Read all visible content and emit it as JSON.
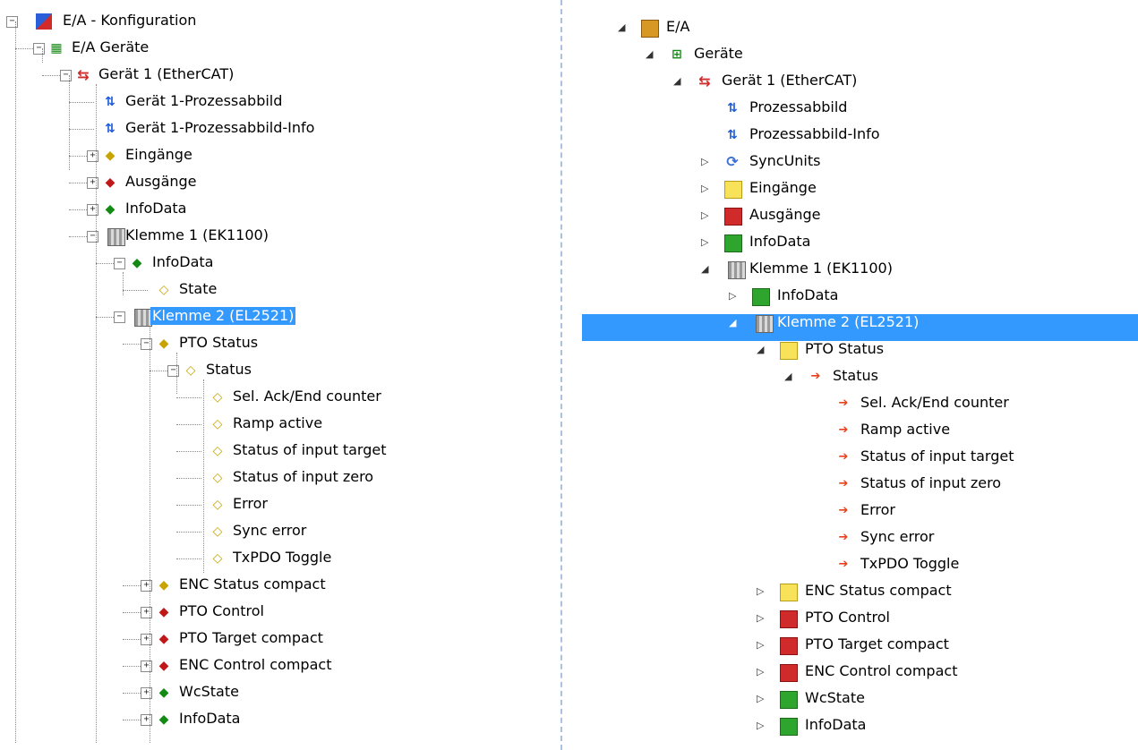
{
  "left_tree": {
    "root": "E/A - Konfiguration",
    "items": [
      {
        "label": "E/A Geräte",
        "level": 1,
        "icon": "device-group-icon",
        "expander": "minus"
      },
      {
        "label": "Gerät 1 (EtherCAT)",
        "level": 2,
        "icon": "ethercat-device-icon",
        "expander": "minus"
      },
      {
        "label": "Gerät 1-Prozessabbild",
        "level": 3,
        "icon": "process-image-icon",
        "expander": "none"
      },
      {
        "label": "Gerät 1-Prozessabbild-Info",
        "level": 3,
        "icon": "process-image-icon",
        "expander": "none"
      },
      {
        "label": "Eingänge",
        "level": 3,
        "icon": "input-icon",
        "expander": "plus"
      },
      {
        "label": "Ausgänge",
        "level": 3,
        "icon": "output-icon",
        "expander": "plus"
      },
      {
        "label": "InfoData",
        "level": 3,
        "icon": "infodata-icon",
        "expander": "plus"
      },
      {
        "label": "Klemme 1 (EK1100)",
        "level": 3,
        "icon": "terminal-icon",
        "expander": "minus"
      },
      {
        "label": "InfoData",
        "level": 4,
        "icon": "infodata-icon",
        "expander": "minus"
      },
      {
        "label": "State",
        "level": 5,
        "icon": "input-variable-icon",
        "expander": "none"
      },
      {
        "label": "Klemme 2 (EL2521)",
        "level": 4,
        "icon": "terminal-icon",
        "expander": "minus",
        "selected": true
      },
      {
        "label": "PTO Status",
        "level": 5,
        "icon": "input-icon",
        "expander": "minus"
      },
      {
        "label": "Status",
        "level": 6,
        "icon": "input-variable-icon",
        "expander": "minus"
      },
      {
        "label": "Sel. Ack/End counter",
        "level": 7,
        "icon": "input-variable-icon",
        "expander": "none"
      },
      {
        "label": "Ramp active",
        "level": 7,
        "icon": "input-variable-icon",
        "expander": "none"
      },
      {
        "label": "Status of input target",
        "level": 7,
        "icon": "input-variable-icon",
        "expander": "none"
      },
      {
        "label": "Status of input zero",
        "level": 7,
        "icon": "input-variable-icon",
        "expander": "none"
      },
      {
        "label": "Error",
        "level": 7,
        "icon": "input-variable-icon",
        "expander": "none"
      },
      {
        "label": "Sync error",
        "level": 7,
        "icon": "input-variable-icon",
        "expander": "none"
      },
      {
        "label": "TxPDO Toggle",
        "level": 7,
        "icon": "input-variable-icon",
        "expander": "none"
      },
      {
        "label": "ENC Status compact",
        "level": 5,
        "icon": "input-icon",
        "expander": "plus"
      },
      {
        "label": "PTO Control",
        "level": 5,
        "icon": "output-icon",
        "expander": "plus"
      },
      {
        "label": "PTO Target compact",
        "level": 5,
        "icon": "output-icon",
        "expander": "plus"
      },
      {
        "label": "ENC Control compact",
        "level": 5,
        "icon": "output-icon",
        "expander": "plus"
      },
      {
        "label": "WcState",
        "level": 5,
        "icon": "infodata-icon",
        "expander": "plus"
      },
      {
        "label": "InfoData",
        "level": 5,
        "icon": "infodata-icon",
        "expander": "plus"
      }
    ]
  },
  "right_tree": {
    "items": [
      {
        "label": "E/A",
        "level": 0,
        "icon": "io-folder-icon",
        "expander": "open"
      },
      {
        "label": "Geräte",
        "level": 1,
        "icon": "devices-icon",
        "expander": "open"
      },
      {
        "label": "Gerät 1 (EtherCAT)",
        "level": 2,
        "icon": "ethercat-device-icon",
        "expander": "open"
      },
      {
        "label": "Prozessabbild",
        "level": 3,
        "icon": "process-image-icon",
        "expander": "none"
      },
      {
        "label": "Prozessabbild-Info",
        "level": 3,
        "icon": "process-image-icon",
        "expander": "none"
      },
      {
        "label": "SyncUnits",
        "level": 3,
        "icon": "sync-units-icon",
        "expander": "closed"
      },
      {
        "label": "Eingänge",
        "level": 3,
        "icon": "input-folder-icon",
        "expander": "closed"
      },
      {
        "label": "Ausgänge",
        "level": 3,
        "icon": "output-folder-icon",
        "expander": "closed"
      },
      {
        "label": "InfoData",
        "level": 3,
        "icon": "infodata-folder-icon",
        "expander": "closed"
      },
      {
        "label": "Klemme 1 (EK1100)",
        "level": 3,
        "icon": "terminal-icon",
        "expander": "open"
      },
      {
        "label": "InfoData",
        "level": 4,
        "icon": "infodata-folder-icon",
        "expander": "closed"
      },
      {
        "label": "Klemme 2 (EL2521)",
        "level": 4,
        "icon": "terminal-icon",
        "expander": "open",
        "selected": true
      },
      {
        "label": "PTO Status",
        "level": 5,
        "icon": "input-folder-icon",
        "expander": "open"
      },
      {
        "label": "Status",
        "level": 6,
        "icon": "input-variable-icon",
        "expander": "open"
      },
      {
        "label": "Sel. Ack/End counter",
        "level": 7,
        "icon": "input-variable-icon",
        "expander": "none"
      },
      {
        "label": "Ramp active",
        "level": 7,
        "icon": "input-variable-icon",
        "expander": "none"
      },
      {
        "label": "Status of input target",
        "level": 7,
        "icon": "input-variable-icon",
        "expander": "none"
      },
      {
        "label": "Status of input zero",
        "level": 7,
        "icon": "input-variable-icon",
        "expander": "none"
      },
      {
        "label": "Error",
        "level": 7,
        "icon": "input-variable-icon",
        "expander": "none"
      },
      {
        "label": "Sync error",
        "level": 7,
        "icon": "input-variable-icon",
        "expander": "none"
      },
      {
        "label": "TxPDO Toggle",
        "level": 7,
        "icon": "input-variable-icon",
        "expander": "none"
      },
      {
        "label": "ENC Status compact",
        "level": 5,
        "icon": "input-folder-icon",
        "expander": "closed"
      },
      {
        "label": "PTO Control",
        "level": 5,
        "icon": "output-folder-icon",
        "expander": "closed"
      },
      {
        "label": "PTO Target compact",
        "level": 5,
        "icon": "output-folder-icon",
        "expander": "closed"
      },
      {
        "label": "ENC Control compact",
        "level": 5,
        "icon": "output-folder-icon",
        "expander": "closed"
      },
      {
        "label": "WcState",
        "level": 5,
        "icon": "infodata-folder-icon",
        "expander": "closed"
      },
      {
        "label": "InfoData",
        "level": 5,
        "icon": "infodata-folder-icon",
        "expander": "closed"
      }
    ]
  },
  "colors": {
    "selection": "#3399ff",
    "divider": "#a9c3df",
    "input": "#f7e25a",
    "output": "#d12a2a",
    "infodata": "#2ea62e"
  }
}
